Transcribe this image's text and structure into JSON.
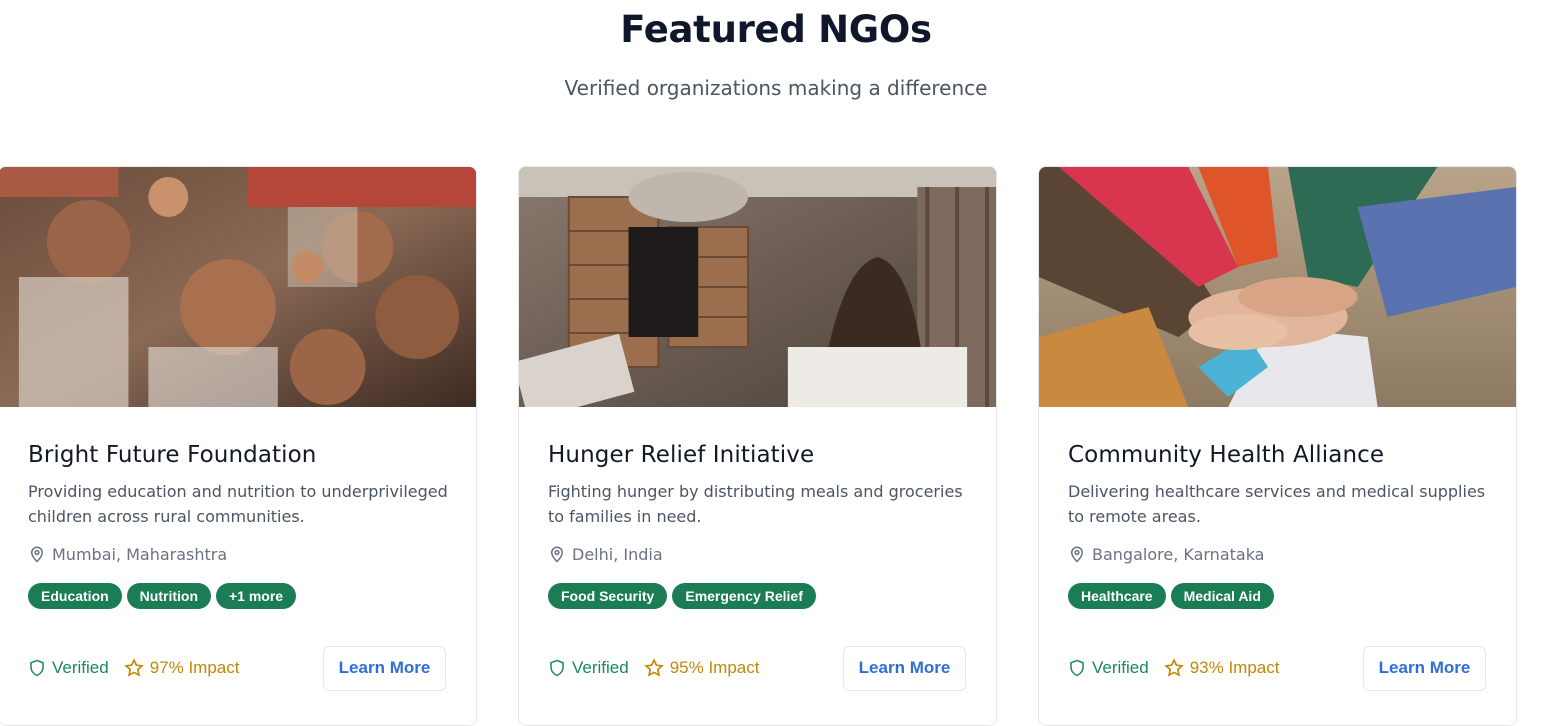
{
  "header": {
    "title": "Featured NGOs",
    "subtitle": "Verified organizations making a difference"
  },
  "cards": [
    {
      "title": "Bright Future Foundation",
      "description": "Providing education and nutrition to underprivileged children across rural communities.",
      "location": "Mumbai, Maharashtra",
      "tags": [
        "Education",
        "Nutrition",
        "+1 more"
      ],
      "verified_label": "Verified",
      "impact_label": "97% Impact",
      "button_label": "Learn More",
      "image_icon": "children-photo"
    },
    {
      "title": "Hunger Relief Initiative",
      "description": "Fighting hunger by distributing meals and groceries to families in need.",
      "location": "Delhi, India",
      "tags": [
        "Food Security",
        "Emergency Relief"
      ],
      "verified_label": "Verified",
      "impact_label": "95% Impact",
      "button_label": "Learn More",
      "image_icon": "food-boxes-photo"
    },
    {
      "title": "Community Health Alliance",
      "description": "Delivering healthcare services and medical supplies to remote areas.",
      "location": "Bangalore, Karnataka",
      "tags": [
        "Healthcare",
        "Medical Aid"
      ],
      "verified_label": "Verified",
      "impact_label": "93% Impact",
      "button_label": "Learn More",
      "image_icon": "stacked-hands-photo"
    }
  ],
  "colors": {
    "tag_bg": "#1a7d55",
    "verified": "#1a8a57",
    "impact": "#c28a07",
    "button_text": "#2f6fd6"
  }
}
